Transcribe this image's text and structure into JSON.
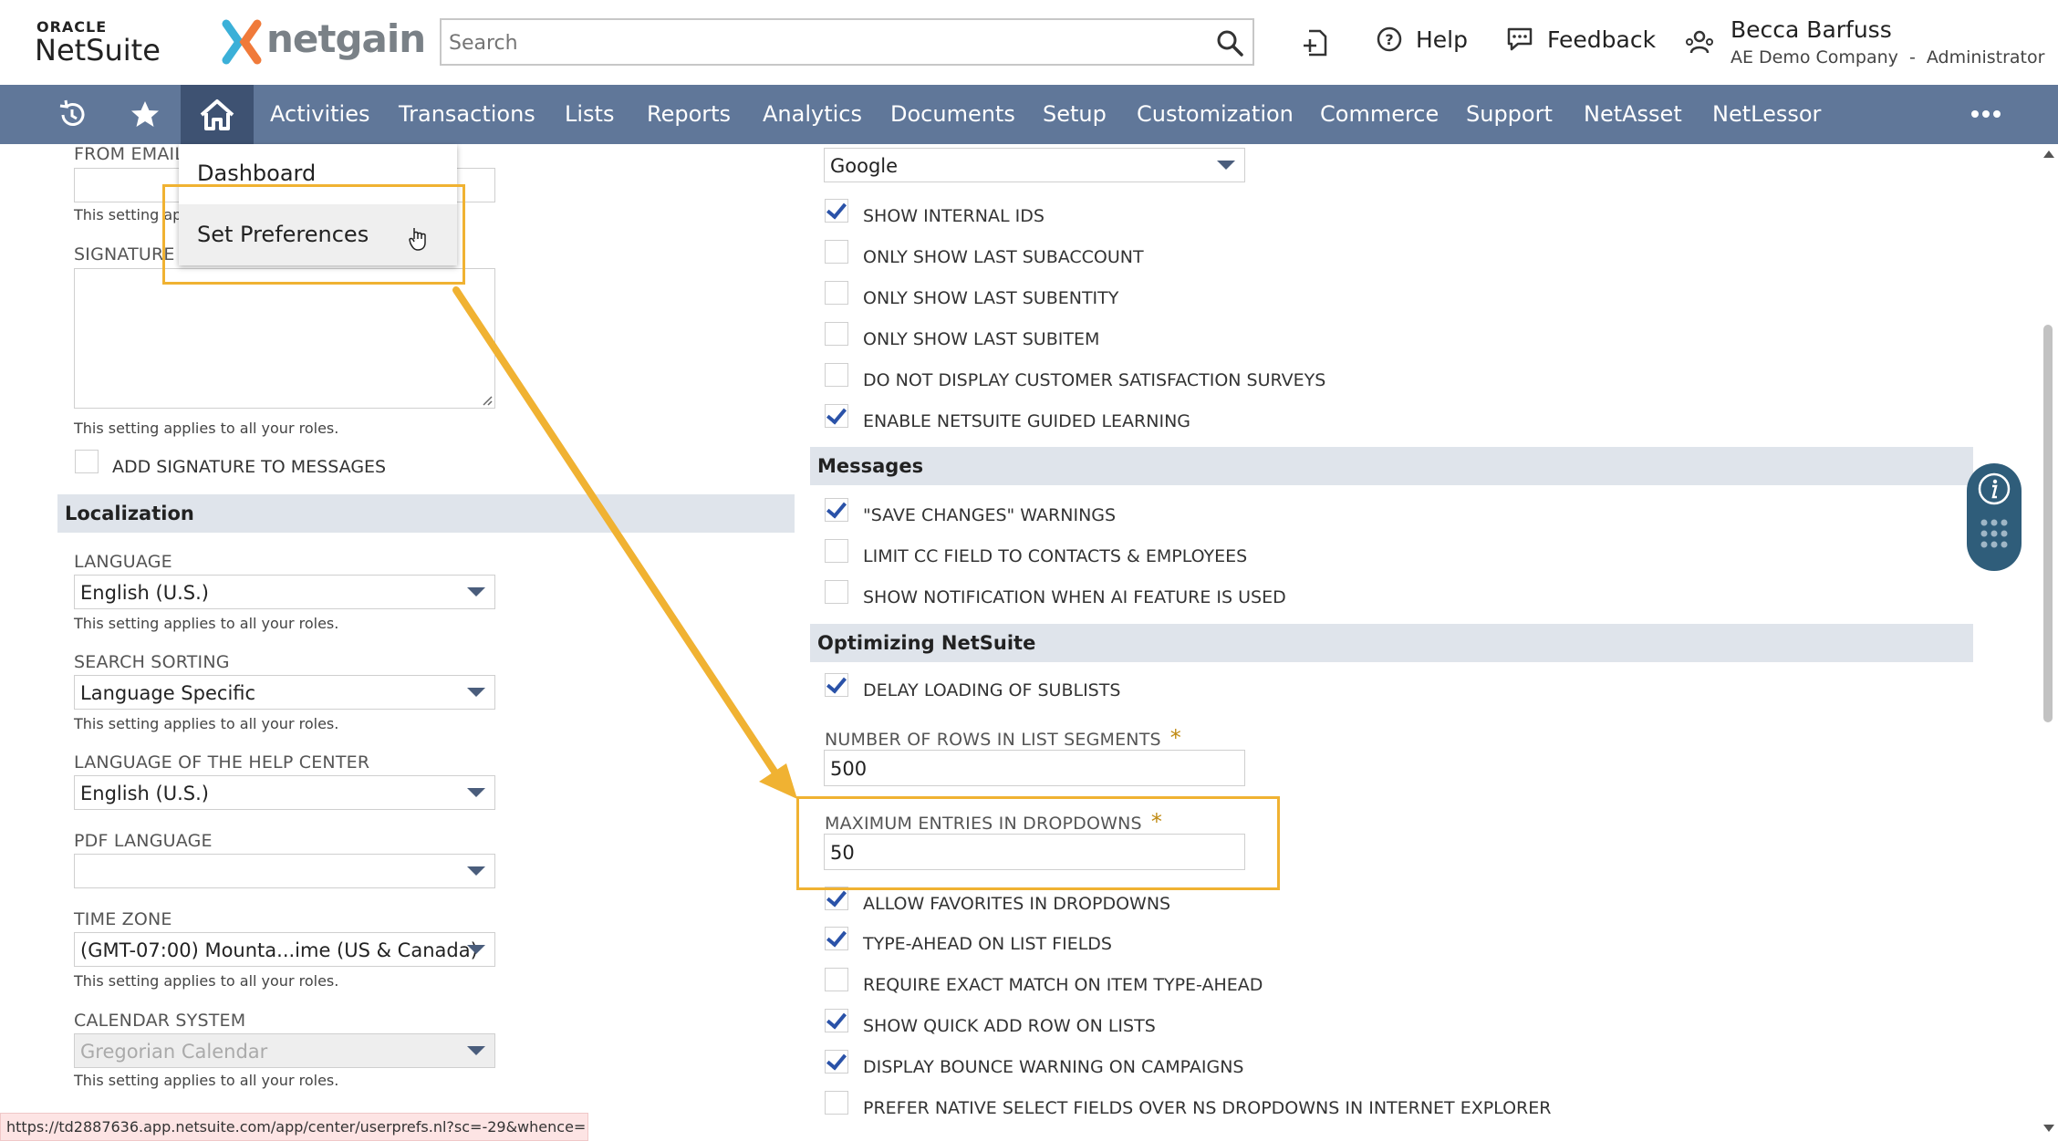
{
  "header": {
    "oracle_logo": "ORACLE",
    "netsuite_logo": "NetSuite",
    "netgain_logo": "netgain",
    "search_placeholder": "Search",
    "help_label": "Help",
    "feedback_label": "Feedback",
    "user_name": "Becca Barfuss",
    "user_company": "AE Demo Company",
    "user_separator": "-",
    "user_role": "Administrator"
  },
  "nav": {
    "items": [
      "Activities",
      "Transactions",
      "Lists",
      "Reports",
      "Analytics",
      "Documents",
      "Setup",
      "Customization",
      "Commerce",
      "Support",
      "NetAsset",
      "NetLessor"
    ]
  },
  "dropdown": {
    "items": [
      "Dashboard",
      "Set Preferences"
    ]
  },
  "left": {
    "from_email_label": "FROM EMAIL",
    "from_email_help": "This setting ap",
    "signature_label": "SIGNATURE",
    "signature_help": "This setting applies to all your roles.",
    "add_signature_label": "ADD SIGNATURE TO MESSAGES",
    "localization_header": "Localization",
    "language_label": "LANGUAGE",
    "language_value": "English (U.S.)",
    "language_help": "This setting applies to all your roles.",
    "search_sorting_label": "SEARCH SORTING",
    "search_sorting_value": "Language Specific",
    "search_sorting_help": "This setting applies to all your roles.",
    "help_center_label": "LANGUAGE OF THE HELP CENTER",
    "help_center_value": "English (U.S.)",
    "pdf_language_label": "PDF LANGUAGE",
    "pdf_language_value": "",
    "time_zone_label": "TIME ZONE",
    "time_zone_value": "(GMT-07:00) Mounta...ime (US & Canada)",
    "time_zone_help": "This setting applies to all your roles.",
    "calendar_label": "CALENDAR SYSTEM",
    "calendar_value": "Gregorian Calendar",
    "calendar_help": "This setting applies to all your roles."
  },
  "right": {
    "search_engine_value": "Google",
    "general_checks": [
      {
        "label": "SHOW INTERNAL IDS",
        "checked": true
      },
      {
        "label": "ONLY SHOW LAST SUBACCOUNT",
        "checked": false
      },
      {
        "label": "ONLY SHOW LAST SUBENTITY",
        "checked": false
      },
      {
        "label": "ONLY SHOW LAST SUBITEM",
        "checked": false
      },
      {
        "label": "DO NOT DISPLAY CUSTOMER SATISFACTION SURVEYS",
        "checked": false
      },
      {
        "label": "ENABLE NETSUITE GUIDED LEARNING",
        "checked": true
      }
    ],
    "messages_header": "Messages",
    "message_checks": [
      {
        "label": "\"SAVE CHANGES\" WARNINGS",
        "checked": true
      },
      {
        "label": "LIMIT CC FIELD TO CONTACTS & EMPLOYEES",
        "checked": false
      },
      {
        "label": "SHOW NOTIFICATION WHEN AI FEATURE IS USED",
        "checked": false
      }
    ],
    "optimizing_header": "Optimizing NetSuite",
    "delay_loading_label": "DELAY LOADING OF SUBLISTS",
    "rows_label": "NUMBER OF ROWS IN LIST SEGMENTS",
    "rows_value": "500",
    "max_entries_label": "MAXIMUM ENTRIES IN DROPDOWNS",
    "max_entries_value": "50",
    "required_mark": "*",
    "optimizing_checks": [
      {
        "label": "ALLOW FAVORITES IN DROPDOWNS",
        "checked": true
      },
      {
        "label": "TYPE-AHEAD ON LIST FIELDS",
        "checked": true
      },
      {
        "label": "REQUIRE EXACT MATCH ON ITEM TYPE-AHEAD",
        "checked": false
      },
      {
        "label": "SHOW QUICK ADD ROW ON LISTS",
        "checked": true
      },
      {
        "label": "DISPLAY BOUNCE WARNING ON CAMPAIGNS",
        "checked": true
      },
      {
        "label": "PREFER NATIVE SELECT FIELDS OVER NS DROPDOWNS IN INTERNET EXPLORER",
        "checked": false
      }
    ]
  },
  "statusbar": {
    "url": "https://td2887636.app.netsuite.com/app/center/userprefs.nl?sc=-29&whence="
  },
  "colors": {
    "nav_bg": "#607799",
    "nav_active": "#3e5272",
    "highlight": "#f0b232",
    "section_bg": "#dfe4eb"
  }
}
